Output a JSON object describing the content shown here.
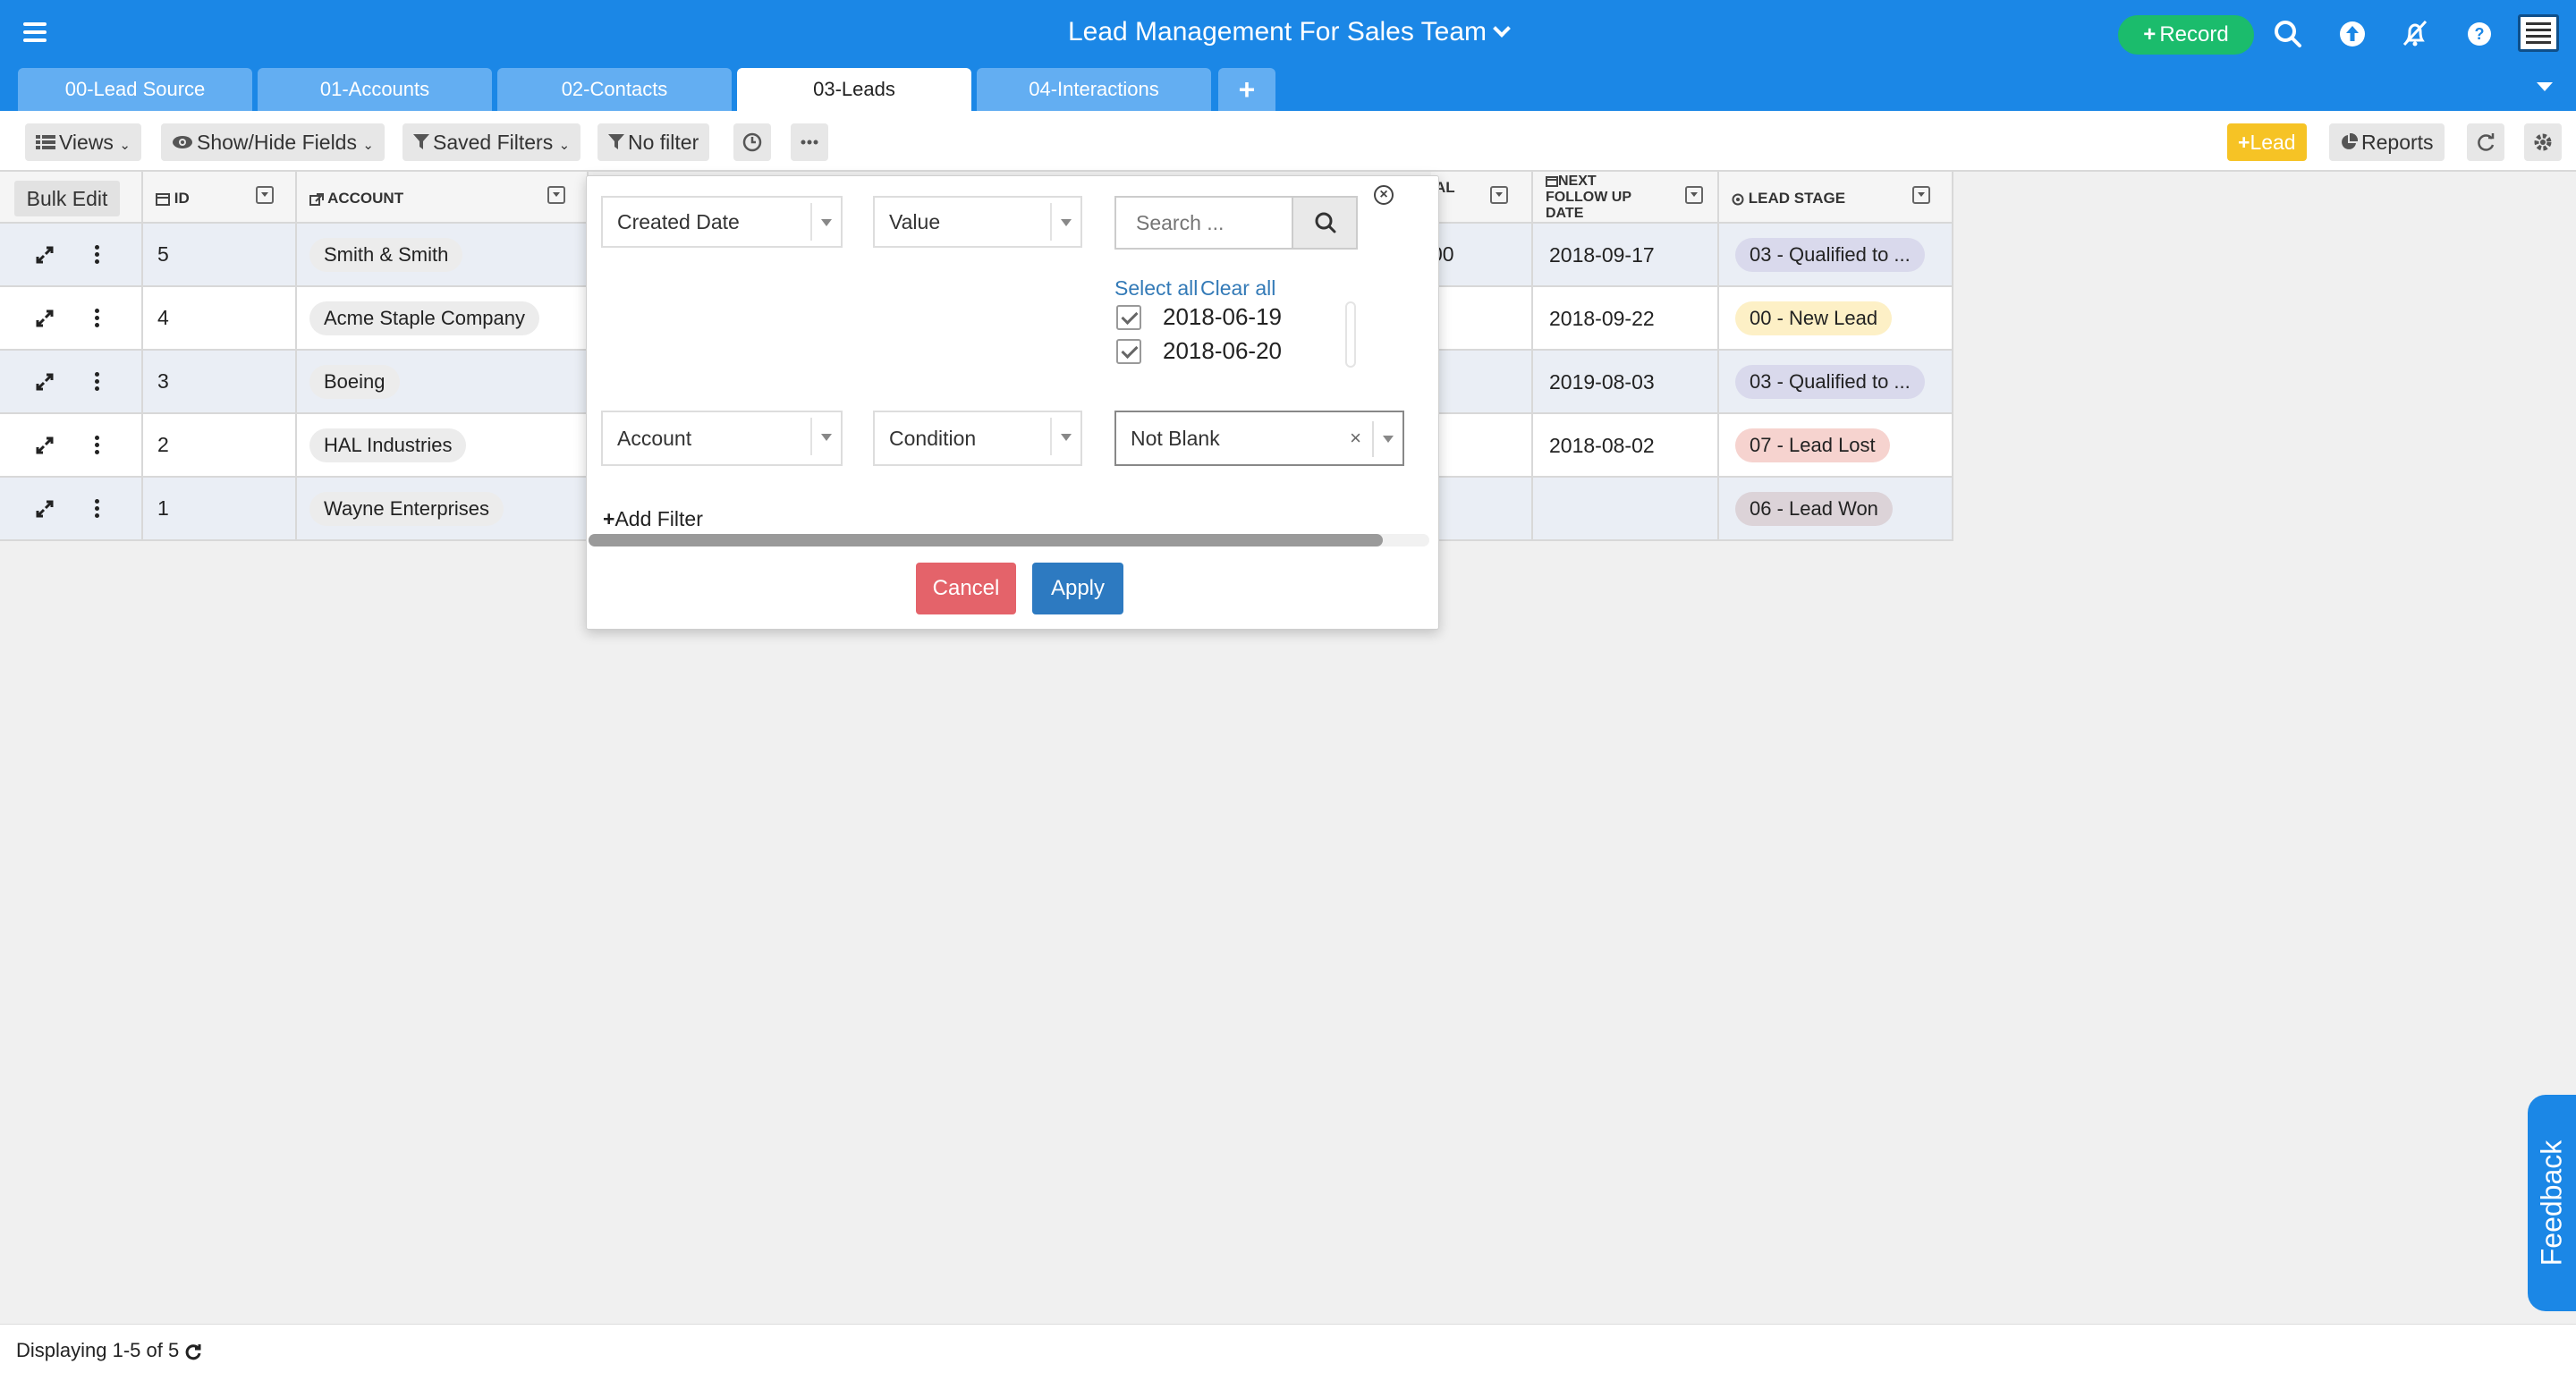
{
  "header": {
    "title": "Lead Management For Sales Team",
    "record_button": "Record"
  },
  "tabs": [
    {
      "label": "00-Lead Source"
    },
    {
      "label": "01-Accounts"
    },
    {
      "label": "02-Contacts"
    },
    {
      "label": "03-Leads",
      "active": true
    },
    {
      "label": "04-Interactions"
    }
  ],
  "toolbar": {
    "views": "Views",
    "show_hide": "Show/Hide Fields",
    "saved_filters": "Saved Filters",
    "no_filter": "No filter",
    "lead_button": "Lead",
    "reports": "Reports"
  },
  "table": {
    "bulk_edit": "Bulk Edit",
    "columns": {
      "id": "ID",
      "account": "ACCOUNT",
      "hidden_col_fragment": "AL",
      "next_follow_up": "NEXT FOLLOW UP DATE",
      "lead_stage": "LEAD STAGE"
    },
    "rows": [
      {
        "id": "5",
        "account": "Smith & Smith",
        "hidden_fragment": "00",
        "next_follow_up": "2018-09-17",
        "lead_stage": "03 - Qualified to ...",
        "stage_color": "#d9d9ec"
      },
      {
        "id": "4",
        "account": "Acme Staple Company",
        "hidden_fragment": ")",
        "next_follow_up": "2018-09-22",
        "lead_stage": "00 - New Lead",
        "stage_color": "#fdf0c6"
      },
      {
        "id": "3",
        "account": "Boeing",
        "hidden_fragment": ")",
        "next_follow_up": "2019-08-03",
        "lead_stage": "03 - Qualified to ...",
        "stage_color": "#d9d9ec"
      },
      {
        "id": "2",
        "account": "HAL Industries",
        "hidden_fragment": ")",
        "next_follow_up": "2018-08-02",
        "lead_stage": "07 - Lead Lost",
        "stage_color": "#f6d3cf"
      },
      {
        "id": "1",
        "account": "Wayne Enterprises",
        "hidden_fragment": ")",
        "next_follow_up": "",
        "lead_stage": "06 - Lead Won",
        "stage_color": "#dcd3d8"
      }
    ]
  },
  "filter_popup": {
    "row1": {
      "field": "Created Date",
      "operator": "Value",
      "search_placeholder": "Search ..."
    },
    "select_all": "Select all",
    "clear_all": "Clear all",
    "values": [
      "2018-06-19",
      "2018-06-20"
    ],
    "row2": {
      "field": "Account",
      "operator": "Condition",
      "condition_value": "Not Blank"
    },
    "add_filter": "Add Filter",
    "cancel": "Cancel",
    "apply": "Apply"
  },
  "footer": {
    "status": "Displaying 1-5 of 5"
  },
  "feedback": "Feedback",
  "colors": {
    "header": "#1b87e6",
    "record": "#1bbc6c",
    "lead": "#f6c325",
    "cancel": "#e4636a",
    "apply": "#2d7ac1"
  },
  "icons": [
    "menu-icon",
    "search-icon",
    "upload-icon",
    "notifications-off-icon",
    "help-icon",
    "avatar-icon",
    "list-icon",
    "eye-icon",
    "filter-icon",
    "clock-icon",
    "more-icon",
    "pie-chart-icon",
    "refresh-icon",
    "gear-icon",
    "expand-icon",
    "kebab-icon"
  ]
}
